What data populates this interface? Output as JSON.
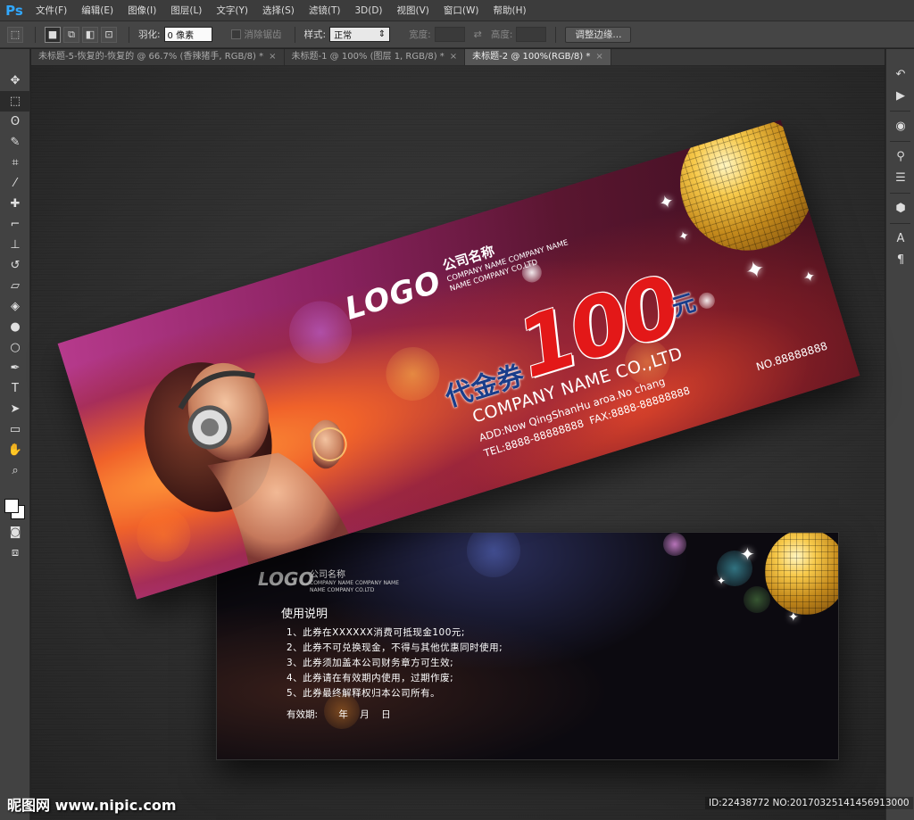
{
  "app": {
    "logo": "Ps"
  },
  "menu": [
    "文件(F)",
    "编辑(E)",
    "图像(I)",
    "图层(L)",
    "文字(Y)",
    "选择(S)",
    "滤镜(T)",
    "3D(D)",
    "视图(V)",
    "窗口(W)",
    "帮助(H)"
  ],
  "options": {
    "feather_label": "羽化:",
    "feather_value": "0 像素",
    "antialias_label": "消除锯齿",
    "style_label": "样式:",
    "style_value": "正常",
    "width_label": "宽度:",
    "height_label": "高度:",
    "refine_edge_button": "调整边缘..."
  },
  "tabs": [
    {
      "title": "未标题-5-恢复的-恢复的 @ 66.7% (香辣猪手, RGB/8) *",
      "active": false
    },
    {
      "title": "未标题-1 @ 100% (图层 1, RGB/8) *",
      "active": false
    },
    {
      "title": "未标题-2 @ 100%(RGB/8) *",
      "active": true
    }
  ],
  "icons": {
    "tools": [
      "move-icon",
      "marquee-icon",
      "lasso-icon",
      "quick-select-icon",
      "crop-icon",
      "eyedropper-icon",
      "healing-icon",
      "brush-icon",
      "stamp-icon",
      "history-brush-icon",
      "eraser-icon",
      "bucket-icon",
      "blur-icon",
      "dodge-icon",
      "pen-icon",
      "type-icon",
      "path-select-icon",
      "rectangle-icon",
      "hand-icon",
      "zoom-icon"
    ],
    "dock": [
      "history-icon",
      "play-icon",
      "color-icon",
      "adjust-icon",
      "properties-icon",
      "3d-icon",
      "character-icon",
      "paragraph-icon"
    ]
  },
  "front": {
    "logo": "LOGO",
    "company_cn": "公司名称",
    "company_en1": "COMPANY NAME COMPANY NAME",
    "company_en2": "NAME COMPANY CO.LTD",
    "title": "代金券",
    "amount": "100",
    "unit": "元",
    "co_name": "COMPANY NAME CO.,LTD",
    "address": "ADD:Now QingShanHu aroa.No chang",
    "fax": "FAX:8888-88888888",
    "tel": "TEL:8888-88888888",
    "number": "NO.88888888"
  },
  "back": {
    "logo": "LOGO",
    "company_cn": "公司名称",
    "company_en1": "COMPANY NAME COMPANY NAME",
    "company_en2": "NAME COMPANY CO.LTD",
    "instr_title": "使用说明",
    "rules": [
      "1、此券在XXXXXX消费可抵现金100元;",
      "2、此券不可兑换现金，不得与其他优惠同时使用;",
      "3、此券须加盖本公司财务章方可生效;",
      "4、此券请在有效期内使用，过期作废;",
      "5、此券最终解释权归本公司所有。"
    ],
    "validity": "有效期:       年    月    日"
  },
  "watermark": {
    "left": "昵图网 www.nipic.com",
    "right": "ID:22438772 NO:20170325141456913000"
  }
}
